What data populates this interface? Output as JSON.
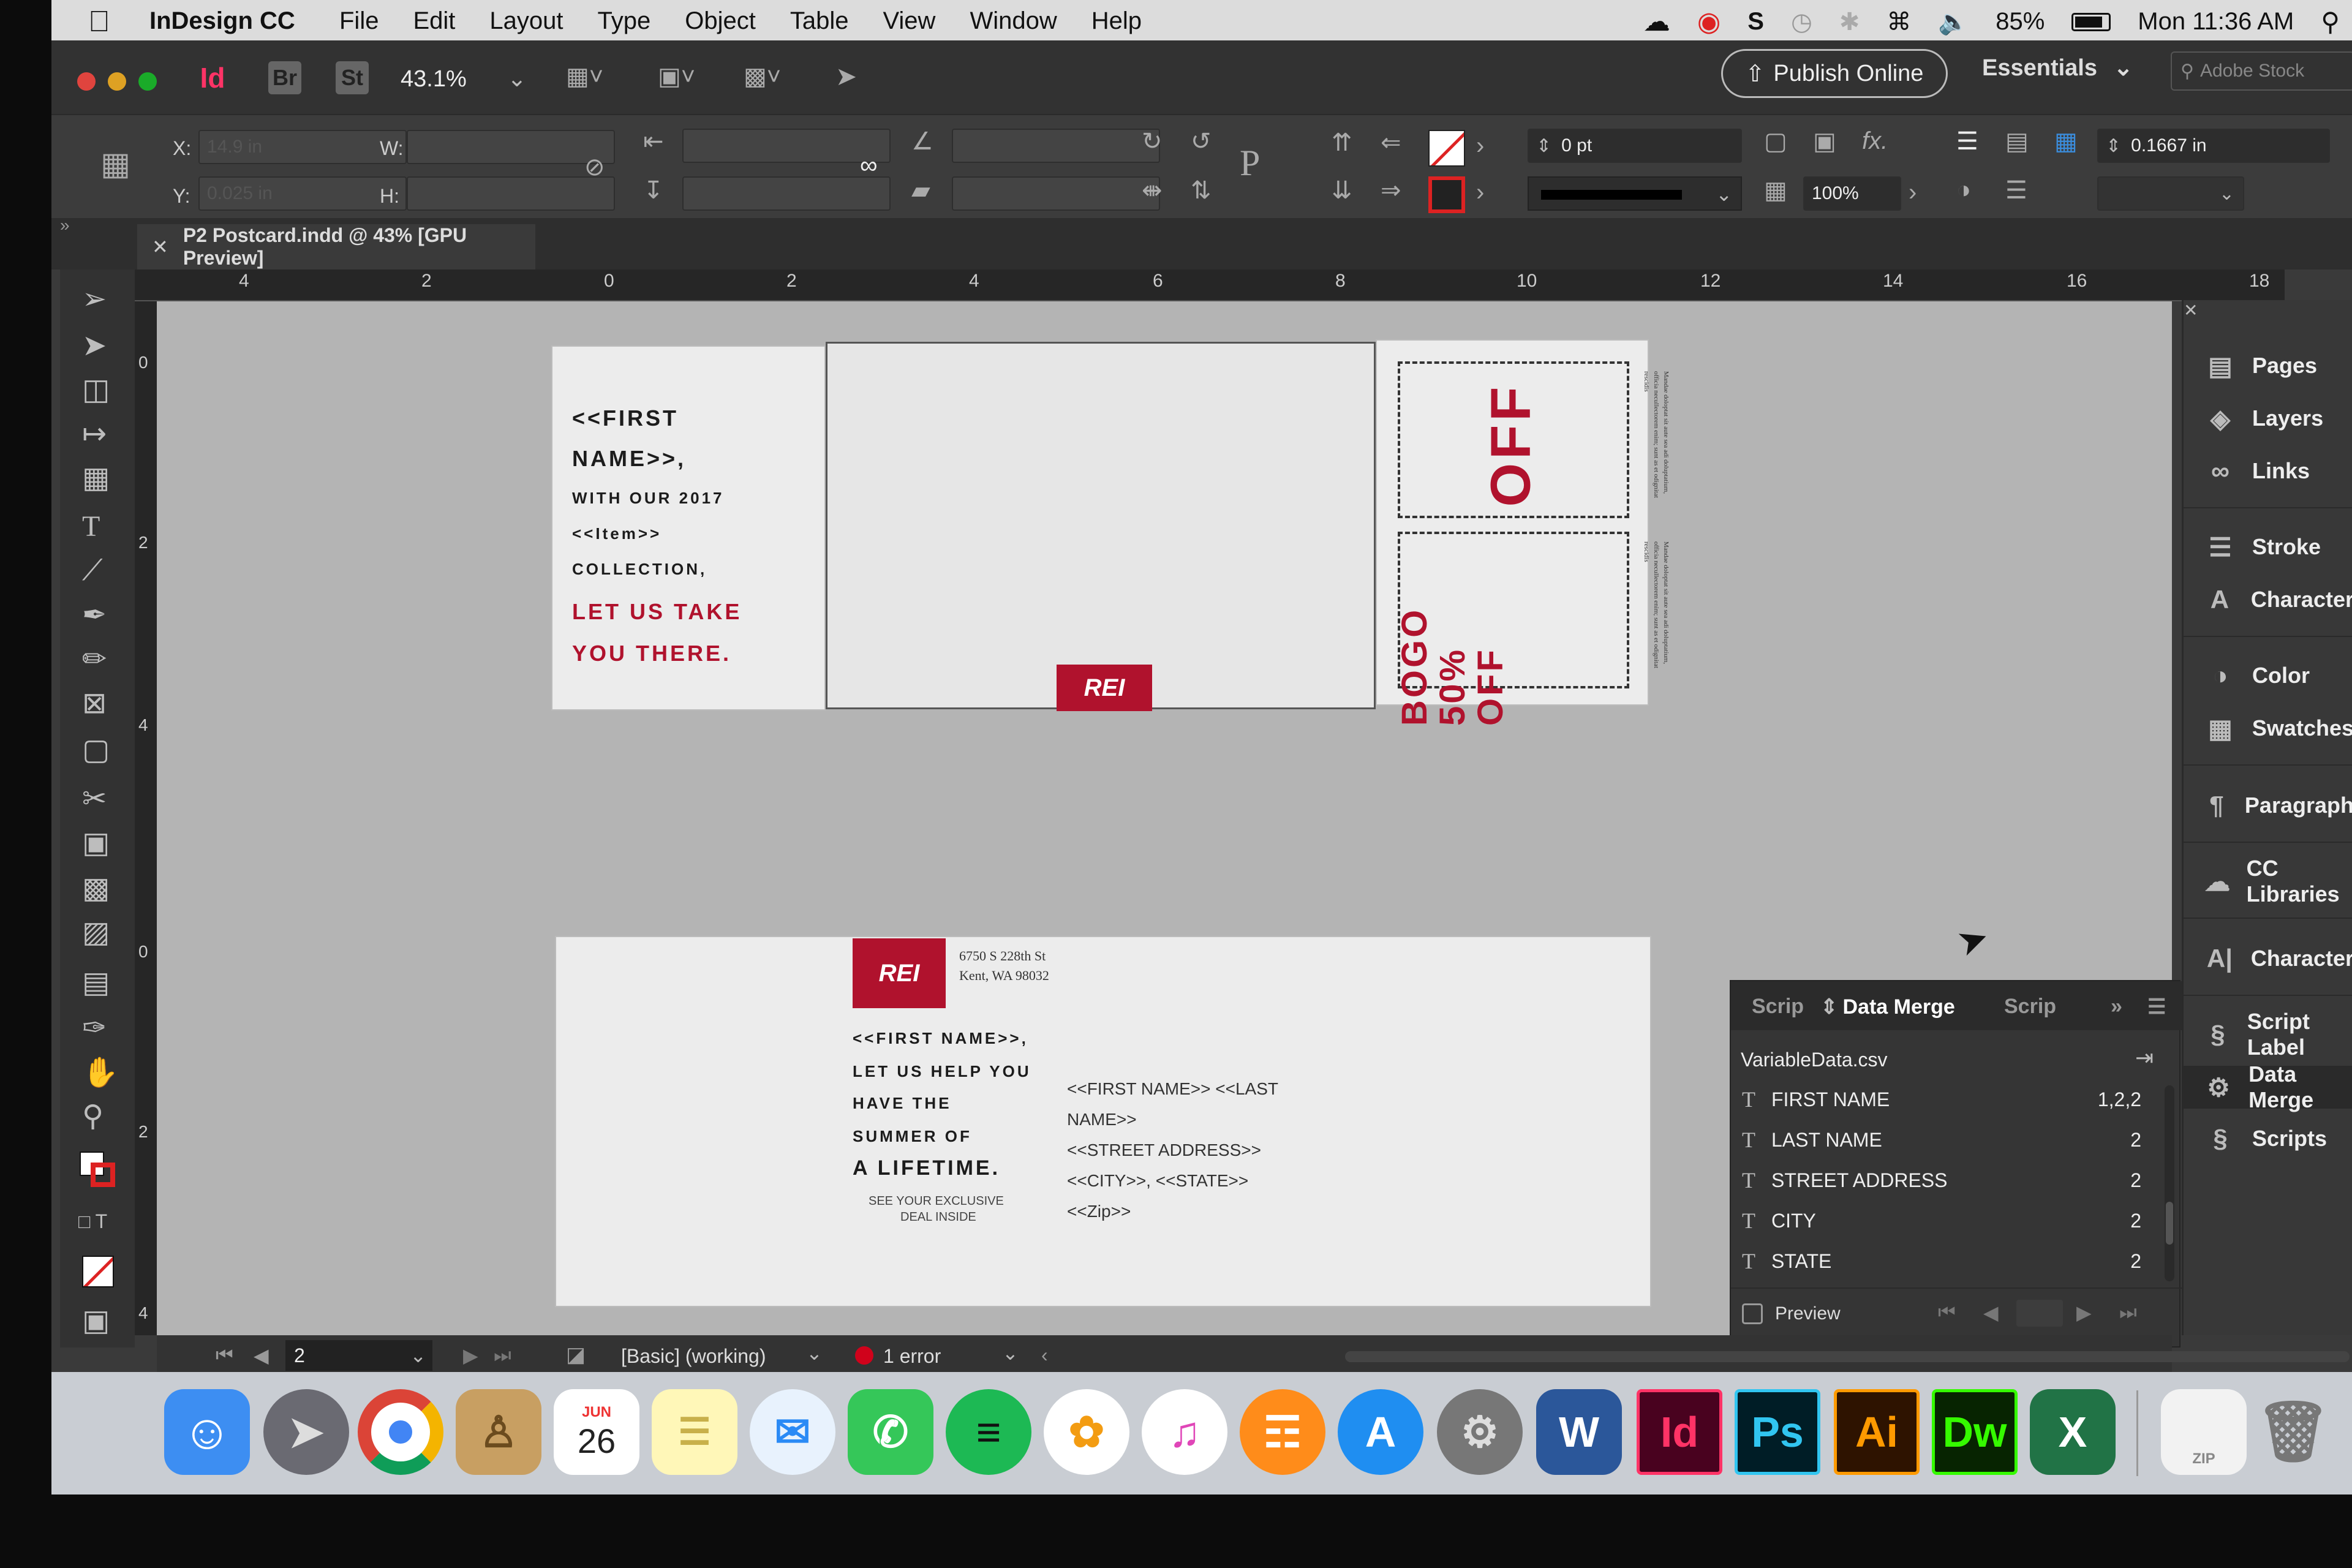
{
  "menubar": {
    "app_name": "InDesign CC",
    "menus": [
      "File",
      "Edit",
      "Layout",
      "Type",
      "Object",
      "Table",
      "View",
      "Window",
      "Help"
    ],
    "battery": "85%",
    "clock": "Mon 11:36 AM"
  },
  "appbar": {
    "app_logo": "Id",
    "bridge": "Br",
    "stock": "St",
    "zoom": "43.1%",
    "publish_label": "Publish Online",
    "workspace": "Essentials",
    "stock_search_placeholder": "Adobe Stock"
  },
  "control_panel": {
    "x_label": "X:",
    "y_label": "Y:",
    "w_label": "W:",
    "h_label": "H:",
    "x_value": "14.9 in",
    "y_value": "0.025 in",
    "stroke_weight": "0 pt",
    "opacity": "100%",
    "gutter": "0.1667 in"
  },
  "document": {
    "tab_title": "P2 Postcard.indd @ 43% [GPU Preview]"
  },
  "rulers": {
    "h_ticks": [
      "4",
      "2",
      "0",
      "2",
      "4",
      "6",
      "8",
      "10",
      "12",
      "14",
      "16",
      "18"
    ],
    "v_ticks_top": [
      "0",
      "2",
      "4"
    ],
    "v_ticks_bottom": [
      "0",
      "2",
      "4"
    ]
  },
  "front_card": {
    "line1": "<<FIRST",
    "line2": "NAME>>,",
    "line3": "WITH OUR 2017",
    "line4": "<<Item>>",
    "line5": "COLLECTION,",
    "cta1": "LET US TAKE",
    "cta2": "YOU THERE.",
    "logo": "REI",
    "coupon1_title": "OFF",
    "coupon2_title_a": "BOGO",
    "coupon2_title_b": "50%",
    "coupon2_title_c": "OFF",
    "coupon_fine_print": "Mandae doloptat sit aute sea adi doluptatium, officia necullectorem enim; sunt as et odignitat rescidis"
  },
  "back_card": {
    "logo": "REI",
    "address1": "6750 S 228th St",
    "address2": "Kent, WA 98032",
    "line1": "<<FIRST NAME>>,",
    "line2": "LET US HELP YOU",
    "line3": "HAVE THE",
    "line4": "SUMMER OF",
    "line5": "A LIFETIME.",
    "fine1": "SEE YOUR EXCLUSIVE",
    "fine2": "DEAL INSIDE",
    "mail1": "<<FIRST NAME>> <<LAST",
    "mail2": "NAME>>",
    "mail3": "<<STREET ADDRESS>>",
    "mail4": "<<CITY>>, <<STATE>>",
    "mail5": "<<Zip>>"
  },
  "dock_panels": [
    "Pages",
    "Layers",
    "Links",
    "Stroke",
    "Character",
    "Color",
    "Swatches",
    "Paragraph",
    "CC Libraries",
    "Character",
    "Script Label",
    "Data Merge",
    "Scripts"
  ],
  "data_merge": {
    "tab_left": "Scrip",
    "tab_active": "Data Merge",
    "tab_right": "Scrip",
    "source": "VariableData.csv",
    "fields": [
      {
        "name": "FIRST NAME",
        "count": "1,2,2"
      },
      {
        "name": "LAST NAME",
        "count": "2"
      },
      {
        "name": "STREET ADDRESS",
        "count": "2"
      },
      {
        "name": "CITY",
        "count": "2"
      },
      {
        "name": "STATE",
        "count": "2"
      }
    ],
    "field_type": "T",
    "preview_label": "Preview"
  },
  "statusbar": {
    "page": "2",
    "style": "[Basic] (working)",
    "errors": "1 error"
  },
  "os_dock": {
    "calendar_month": "JUN",
    "calendar_day": "26",
    "apps": [
      "Finder",
      "Launchpad",
      "Chrome",
      "Contacts",
      "Calendar",
      "Notes",
      "Messages",
      "FaceTime",
      "Spotify",
      "Photos",
      "iTunes",
      "iBooks",
      "App Store",
      "System Preferences",
      "Word",
      "InDesign",
      "Photoshop",
      "Illustrator",
      "Dreamweaver",
      "Excel",
      "Archive",
      "Trash"
    ],
    "word": "W",
    "indesign": "Id",
    "photoshop": "Ps",
    "illustrator": "Ai",
    "dreamweaver": "Dw",
    "excel": "X",
    "zip": "ZIP"
  },
  "colors": {
    "brand_red": "#b0122d",
    "indesign_pink": "#ff3366",
    "ui_dark": "#323232"
  }
}
